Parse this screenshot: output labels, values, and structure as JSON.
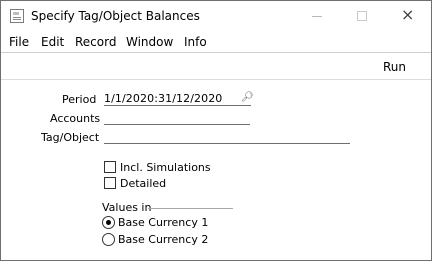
{
  "window": {
    "title": "Specify Tag/Object Balances",
    "app_icon": "document-icon",
    "controls": {
      "minimize": "minimize-icon",
      "maximize": "maximize-icon",
      "close": "×"
    }
  },
  "menubar": {
    "items": [
      "File",
      "Edit",
      "Record",
      "Window",
      "Info"
    ]
  },
  "toolbar": {
    "run_label": "Run"
  },
  "form": {
    "period": {
      "label": "Period",
      "value": "1/1/2020:31/12/2020",
      "paste_icon": "paste-special-icon"
    },
    "accounts": {
      "label": "Accounts",
      "value": ""
    },
    "tag_object": {
      "label": "Tag/Object",
      "value": ""
    },
    "incl_simulations": {
      "label": "Incl. Simulations",
      "checked": false
    },
    "detailed": {
      "label": "Detailed",
      "checked": false
    },
    "values_in": {
      "heading": "Values in",
      "options": [
        {
          "label": "Base Currency 1",
          "selected": true
        },
        {
          "label": "Base Currency 2",
          "selected": false
        }
      ]
    }
  }
}
